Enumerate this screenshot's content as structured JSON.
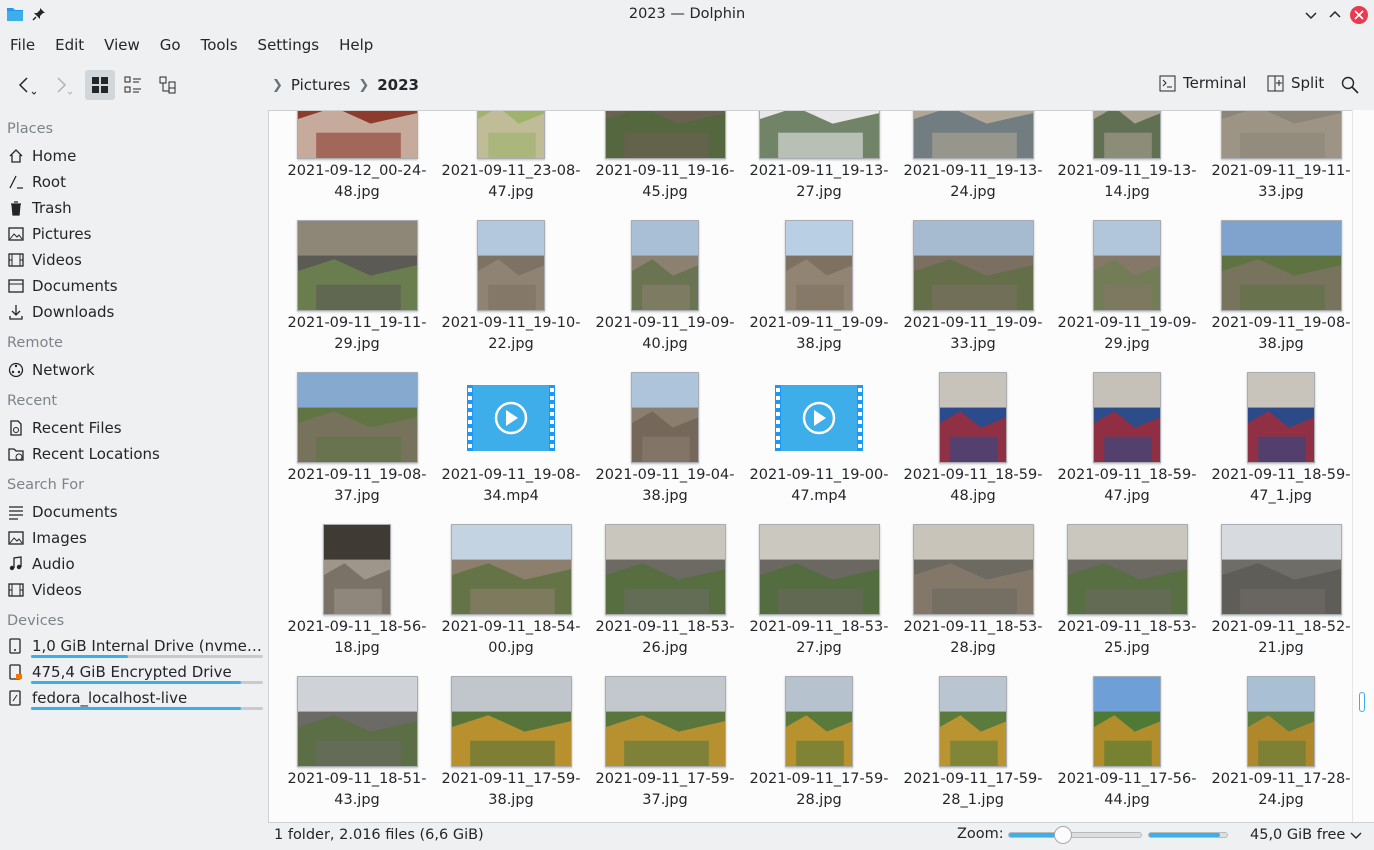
{
  "window": {
    "title": "2023 — Dolphin",
    "icons": [
      "folder-app-icon",
      "pin-icon",
      "minimize-icon",
      "maximize-icon",
      "close-icon"
    ]
  },
  "menu": [
    "File",
    "Edit",
    "View",
    "Go",
    "Tools",
    "Settings",
    "Help"
  ],
  "toolbar": {
    "breadcrumb": [
      "Pictures",
      "2023"
    ],
    "terminal_label": "Terminal",
    "split_label": "Split"
  },
  "sidebar": {
    "places_title": "Places",
    "places": [
      {
        "label": "Home",
        "icon": "home-icon"
      },
      {
        "label": "Root",
        "icon": "root-icon"
      },
      {
        "label": "Trash",
        "icon": "trash-icon"
      },
      {
        "label": "Pictures",
        "icon": "pictures-icon"
      },
      {
        "label": "Videos",
        "icon": "videos-icon"
      },
      {
        "label": "Documents",
        "icon": "documents-icon"
      },
      {
        "label": "Downloads",
        "icon": "downloads-icon"
      }
    ],
    "remote_title": "Remote",
    "remote": [
      {
        "label": "Network",
        "icon": "network-icon"
      }
    ],
    "recent_title": "Recent",
    "recent": [
      {
        "label": "Recent Files",
        "icon": "recent-files-icon"
      },
      {
        "label": "Recent Locations",
        "icon": "recent-locations-icon"
      }
    ],
    "search_title": "Search For",
    "search": [
      {
        "label": "Documents",
        "icon": "documents-icon"
      },
      {
        "label": "Images",
        "icon": "images-icon"
      },
      {
        "label": "Audio",
        "icon": "audio-icon"
      },
      {
        "label": "Videos",
        "icon": "videos-icon"
      }
    ],
    "devices_title": "Devices",
    "devices": [
      {
        "label": "1,0 GiB Internal Drive (nvme0n...",
        "icon": "drive-icon",
        "usage": 0.42
      },
      {
        "label": "475,4 GiB Encrypted Drive",
        "icon": "encrypted-drive-icon",
        "usage": 0.905
      },
      {
        "label": "fedora_localhost-live",
        "icon": "drive-icon",
        "usage": 0.905
      }
    ]
  },
  "files": [
    {
      "name": "2021-09-12_00-24-48.jpg",
      "kind": "landscape",
      "palette": [
        "#b7b0a6",
        "#8c3b2c",
        "#d9d2c3"
      ]
    },
    {
      "name": "2021-09-11_23-08-47.jpg",
      "kind": "portrait",
      "palette": [
        "#e9e4d5",
        "#9fb36c",
        "#c9bfa6"
      ]
    },
    {
      "name": "2021-09-11_19-16-45.jpg",
      "kind": "landscape",
      "palette": [
        "#8f8374",
        "#6b6152",
        "#4e6a3a"
      ]
    },
    {
      "name": "2021-09-11_19-13-27.jpg",
      "kind": "landscape",
      "palette": [
        "#7e8f9e",
        "#e8e8ea",
        "#49633c"
      ]
    },
    {
      "name": "2021-09-11_19-13-24.jpg",
      "kind": "landscape",
      "palette": [
        "#8a8277",
        "#b0a796",
        "#5c6f7a"
      ]
    },
    {
      "name": "2021-09-11_19-13-14.jpg",
      "kind": "portrait",
      "palette": [
        "#858177",
        "#a8a292",
        "#4a5e3c"
      ]
    },
    {
      "name": "2021-09-11_19-11-33.jpg",
      "kind": "landscape",
      "palette": [
        "#c9c4ba",
        "#8c857a",
        "#a49a8a"
      ]
    },
    {
      "name": "2021-09-11_19-11-29.jpg",
      "kind": "landscape",
      "palette": [
        "#8e8778",
        "#5b5a55",
        "#6f8a4e"
      ]
    },
    {
      "name": "2021-09-11_19-10-22.jpg",
      "kind": "portrait",
      "palette": [
        "#b3c8dc",
        "#7d7263",
        "#958979"
      ]
    },
    {
      "name": "2021-09-11_19-09-40.jpg",
      "kind": "portrait",
      "palette": [
        "#a8bfd6",
        "#8c8070",
        "#5f7048"
      ]
    },
    {
      "name": "2021-09-11_19-09-38.jpg",
      "kind": "portrait",
      "palette": [
        "#b9cfe3",
        "#7e7162",
        "#998b78"
      ]
    },
    {
      "name": "2021-09-11_19-09-33.jpg",
      "kind": "landscape",
      "palette": [
        "#a7bbd0",
        "#7a6f61",
        "#5d6f43"
      ]
    },
    {
      "name": "2021-09-11_19-09-29.jpg",
      "kind": "portrait",
      "palette": [
        "#b1c6db",
        "#857868",
        "#6c7d50"
      ]
    },
    {
      "name": "2021-09-11_19-08-38.jpg",
      "kind": "landscape",
      "palette": [
        "#7fa3cc",
        "#5f7342",
        "#7f7366"
      ]
    },
    {
      "name": "2021-09-11_19-08-37.jpg",
      "kind": "landscape",
      "palette": [
        "#86a9d0",
        "#617544",
        "#7d7164"
      ]
    },
    {
      "name": "2021-09-11_19-08-34.mp4",
      "kind": "video",
      "palette": [
        "#3daee9",
        "#1d99f3",
        "#ffffff"
      ]
    },
    {
      "name": "2021-09-11_19-04-38.jpg",
      "kind": "portrait",
      "palette": [
        "#aec4da",
        "#8a7e6f",
        "#6e6254"
      ]
    },
    {
      "name": "2021-09-11_19-00-47.mp4",
      "kind": "video",
      "palette": [
        "#3daee9",
        "#1d99f3",
        "#ffffff"
      ]
    },
    {
      "name": "2021-09-11_18-59-48.jpg",
      "kind": "portrait",
      "palette": [
        "#c7c3bb",
        "#2b4b8c",
        "#b3272c"
      ]
    },
    {
      "name": "2021-09-11_18-59-47.jpg",
      "kind": "portrait",
      "palette": [
        "#c5c1b9",
        "#2d4c8a",
        "#b1262b"
      ]
    },
    {
      "name": "2021-09-11_18-59-47_1.jpg",
      "kind": "portrait",
      "palette": [
        "#c8c4bc",
        "#2c4a88",
        "#b2282d"
      ]
    },
    {
      "name": "2021-09-11_18-56-18.jpg",
      "kind": "portrait",
      "palette": [
        "#3f3a34",
        "#9e968a",
        "#6d655a"
      ]
    },
    {
      "name": "2021-09-11_18-54-00.jpg",
      "kind": "landscape",
      "palette": [
        "#c4d3e2",
        "#8d7f6e",
        "#58703a"
      ]
    },
    {
      "name": "2021-09-11_18-53-26.jpg",
      "kind": "landscape",
      "palette": [
        "#c9c6bd",
        "#6c6a62",
        "#4f7036"
      ]
    },
    {
      "name": "2021-09-11_18-53-27.jpg",
      "kind": "landscape",
      "palette": [
        "#cbc8bf",
        "#6a6860",
        "#4e6f35"
      ]
    },
    {
      "name": "2021-09-11_18-53-28.jpg",
      "kind": "landscape",
      "palette": [
        "#c8c4ba",
        "#6d6a61",
        "#8a7c6b"
      ]
    },
    {
      "name": "2021-09-11_18-53-25.jpg",
      "kind": "landscape",
      "palette": [
        "#cac7be",
        "#6b6961",
        "#51723a"
      ]
    },
    {
      "name": "2021-09-11_18-52-21.jpg",
      "kind": "landscape",
      "palette": [
        "#d7dadf",
        "#6f6d68",
        "#5a5853"
      ]
    },
    {
      "name": "2021-09-11_18-51-43.jpg",
      "kind": "landscape",
      "palette": [
        "#cfd3d8",
        "#6b6a66",
        "#56703b"
      ]
    },
    {
      "name": "2021-09-11_17-59-38.jpg",
      "kind": "landscape",
      "palette": [
        "#c1c6cc",
        "#57753a",
        "#d89a2a"
      ]
    },
    {
      "name": "2021-09-11_17-59-37.jpg",
      "kind": "landscape",
      "palette": [
        "#c3c8ce",
        "#59773c",
        "#d79a2c"
      ]
    },
    {
      "name": "2021-09-11_17-59-28.jpg",
      "kind": "portrait",
      "palette": [
        "#b6c3cf",
        "#5a7a3c",
        "#d89b2b"
      ]
    },
    {
      "name": "2021-09-11_17-59-28_1.jpg",
      "kind": "portrait",
      "palette": [
        "#b9c5d1",
        "#5b7b3d",
        "#d99c2c"
      ]
    },
    {
      "name": "2021-09-11_17-56-44.jpg",
      "kind": "portrait",
      "palette": [
        "#6e9fd6",
        "#4f7a35",
        "#d39428"
      ]
    },
    {
      "name": "2021-09-11_17-28-24.jpg",
      "kind": "portrait",
      "palette": [
        "#a9bfd3",
        "#5d7c3e",
        "#c98c25"
      ]
    }
  ],
  "status": {
    "summary": "1 folder, 2.016 files (6,6 GiB)",
    "zoom_label": "Zoom:",
    "zoom_level": 0.4,
    "free_label": "45,0 GiB free",
    "disk_usage": 0.905,
    "scroll_position": 0.97
  },
  "colors": {
    "accent": "#3daee9",
    "close_button": "#e93a50",
    "window_bg": "#eff0f1",
    "view_bg": "#fcfcfc"
  }
}
